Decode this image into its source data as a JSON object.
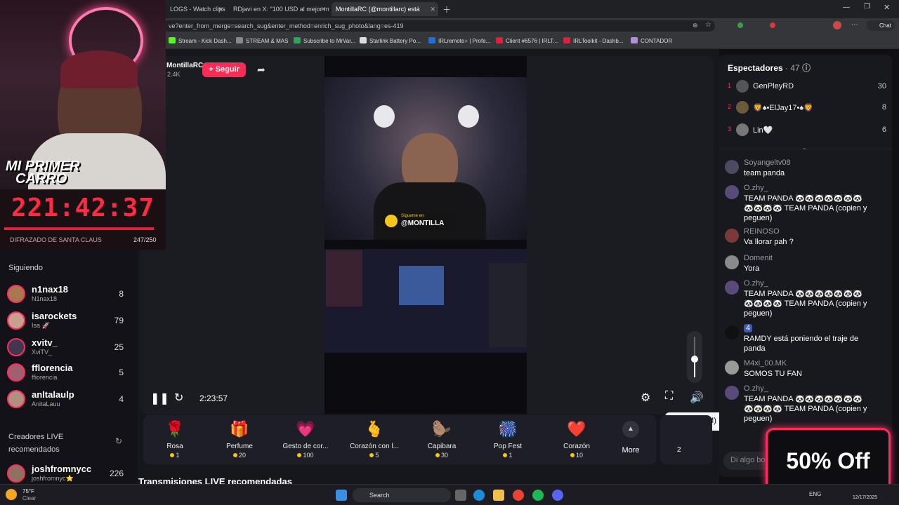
{
  "tabs": [
    {
      "label": "LOGS - Watch clips o",
      "active": false
    },
    {
      "label": "RDjavi en X: \"100 USD al mejor m",
      "active": false
    },
    {
      "label": "MontillaRC (@montillarc) está",
      "active": true
    }
  ],
  "url": "ve?enter_from_merge=search_sug&enter_method=enrich_sug_photo&lang=es-419",
  "chat_button": "Chat",
  "bookmarks": [
    "Stream - Kick Dash...",
    "STREAM & MAS",
    "Subscribe to MrVar...",
    "Starlink Battery Po...",
    "IRLremote+ | Profe...",
    "Client #6576 | IRLT...",
    "IRLToolkit - Dashb...",
    "CONTADOR"
  ],
  "overlay": {
    "banner_line1": "MI PRIMER",
    "banner_line2": "CARRO",
    "timer": "221:42:37",
    "goal_label": "DIFRAZADO DE SANTA CLAUS",
    "goal_count": "247/250",
    "goal_progress": 0.988
  },
  "streamer": {
    "name": "MontillaRC",
    "followers": "2.4K",
    "follow_button": "+ Seguir"
  },
  "sidebar": {
    "following_title": "Siguiendo",
    "following": [
      {
        "name": "n1nax18",
        "sub": "N1nax18",
        "count": "8"
      },
      {
        "name": "isarockets",
        "sub": "Isa 🚀",
        "count": "79"
      },
      {
        "name": "xvitv_",
        "sub": "XviTV_",
        "count": "25"
      },
      {
        "name": "fflorencia",
        "sub": "ffiorencia",
        "count": "5"
      },
      {
        "name": "anltalaulp",
        "sub": "AnitaLauu",
        "count": "4"
      }
    ],
    "recommended_title": "Creadores LIVE recomendados",
    "recommended": [
      {
        "name": "joshfromnycc",
        "sub": "joshfromnyc⭐",
        "count": "226"
      }
    ]
  },
  "video": {
    "overlay_text": "@MONTILLA",
    "overlay_sub": "Sígueme en",
    "time": "2:23:57",
    "volume": 0.45
  },
  "tooltip": "Silenciar (M)",
  "gifts": [
    {
      "name": "Rosa",
      "price": "1",
      "icon": "🌹"
    },
    {
      "name": "Perfume",
      "price": "20",
      "icon": "🎁"
    },
    {
      "name": "Gesto de cor...",
      "price": "100",
      "icon": "💗"
    },
    {
      "name": "Corazón con l...",
      "price": "5",
      "icon": "🫰"
    },
    {
      "name": "Capibara",
      "price": "30",
      "icon": "🦫"
    },
    {
      "name": "Pop Fest",
      "price": "1",
      "icon": "🎆"
    },
    {
      "name": "Corazón",
      "price": "10",
      "icon": "❤️"
    }
  ],
  "more_label": "More",
  "coins_label": "2",
  "section_title": "Transmisiones LIVE recomendadas",
  "chat": {
    "viewers_title": "Espectadores",
    "viewers_count": "· 47",
    "viewers": [
      {
        "rank": "1",
        "name": "GenPleyRD",
        "score": "30"
      },
      {
        "rank": "2",
        "name": "🦁♠•ElJay17•♠🦁",
        "score": "8"
      },
      {
        "rank": "3",
        "name": "Lin🤍",
        "score": "6"
      }
    ],
    "messages": [
      {
        "user": "Soyangeltv08",
        "text": "team panda"
      },
      {
        "user": "O.zhy_",
        "text": "TEAM PANDA 🐼🐼🐼🐼🐼🐼🐼 🐼🐼🐼🐼 TEAM PANDA (copien y peguen)"
      },
      {
        "user": "REINOSO",
        "text": "Va llorar pah ?"
      },
      {
        "user": "Domenit",
        "text": "Yora"
      },
      {
        "user": "O.zhy_",
        "text": "TEAM PANDA 🐼🐼🐼🐼🐼🐼🐼 🐼🐼🐼🐼 TEAM PANDA (copien y peguen)"
      },
      {
        "user": "4",
        "text": "RAMDY está poniendo el traje de panda"
      },
      {
        "user": "M4xi_00.MK",
        "text": "SOMOS TU FAN"
      },
      {
        "user": "O.zhy_",
        "text": "TEAM PANDA 🐼🐼🐼🐼🐼🐼🐼 🐼🐼🐼🐼 TEAM PANDA (copien y peguen)"
      }
    ],
    "input_placeholder": "Di algo bo"
  },
  "promo": "50% Off",
  "taskbar": {
    "weather_temp": "75°F",
    "weather_desc": "Clear",
    "search": "Search",
    "lang": "ENG",
    "date": "12/17/2025"
  }
}
